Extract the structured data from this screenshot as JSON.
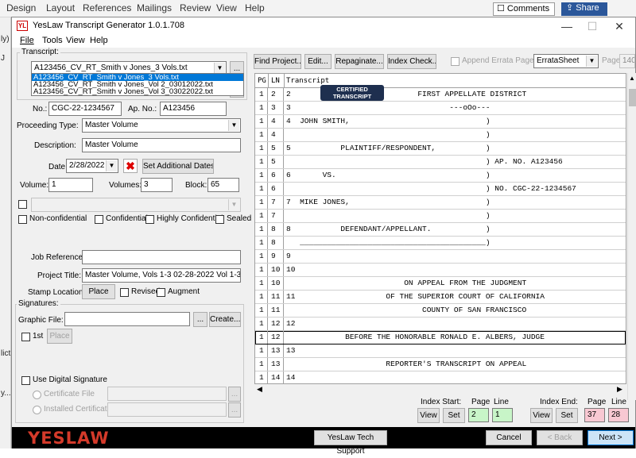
{
  "word": {
    "menu": [
      "Design",
      "Layout",
      "References",
      "Mailings",
      "Review",
      "View",
      "Help"
    ],
    "comments": "Comments",
    "share": "Share",
    "left_fragments": [
      "ly)",
      "J",
      "lict",
      "y..."
    ]
  },
  "window": {
    "title": "YesLaw Transcript Generator 1.0.1.708",
    "icon_text": "YL",
    "minimize": "—",
    "maximize": "☐",
    "close": "✕"
  },
  "menu": {
    "file": "File",
    "tools": "Tools",
    "view": "View",
    "help": "Help"
  },
  "transcript": {
    "legend": "Transcript:",
    "selected": "A123456_CV_RT_Smith v Jones_3 Vols.txt",
    "browse": "...",
    "options": [
      "A123456_CV_RT_Smith v Jones_3 Vols.txt",
      "A123456_CV_RT_Smith v Jones_Vol 2_03012022.txt",
      "A123456_CV_RT_Smith v Jones_Vol 3_03022022.txt"
    ],
    "close_icon": "✖"
  },
  "case": {
    "no_label": "No.:",
    "no_value": "CGC-22-1234567",
    "ap_label": "Ap. No.:",
    "ap_value": "A123456"
  },
  "proceeding": {
    "label": "Proceeding Type:",
    "value": "Master Volume"
  },
  "description": {
    "label": "Description:",
    "value": "Master Volume"
  },
  "date": {
    "label": "Date:",
    "value": "2/28/2022",
    "set_additional": "Set Additional Dates..."
  },
  "volume": {
    "label": "Volume:",
    "value": "1",
    "volumes_label": "Volumes:",
    "volumes_value": "3",
    "block_label": "Block:",
    "block_value": "65"
  },
  "confidentiality": [
    "Non-confidential",
    "Confidential",
    "Highly Confidential",
    "Sealed"
  ],
  "job_reference": {
    "label": "Job Reference:",
    "value": ""
  },
  "project_title": {
    "label": "Project Title:",
    "value": "Master Volume, Vols 1-3 02-28-2022 Vol 1-3"
  },
  "stamp": {
    "label": "Stamp Location:",
    "place": "Place",
    "revised": "Revised",
    "augment": "Augment"
  },
  "signatures": {
    "legend": "Signatures:",
    "graphic_label": "Graphic File:",
    "graphic_value": "",
    "browse": "...",
    "create": "Create...",
    "first": "1st",
    "place": "Place",
    "digital": "Use Digital Signature",
    "cert_file": "Certificate File",
    "installed_cert": "Installed Certificate"
  },
  "toolbar": {
    "find_project": "Find Project...",
    "edit": "Edit...",
    "repaginate": "Repaginate...",
    "index_check": "Index Check...",
    "append_errata": "Append Errata Page",
    "errata_value": "ErrataSheet",
    "page_label": "Page",
    "page_value": "140"
  },
  "table": {
    "headers": {
      "pg": "PG",
      "ln": "LN",
      "transcript": "Transcript"
    },
    "rows": [
      {
        "pg": "1",
        "ln": "2",
        "text": "2                            FIRST APPELLATE DISTRICT"
      },
      {
        "pg": "1",
        "ln": "3",
        "text": "3                                   ---oOo---"
      },
      {
        "pg": "1",
        "ln": "4",
        "text": "4  JOHN SMITH,                              )"
      },
      {
        "pg": "1",
        "ln": "4",
        "text": "                                            )"
      },
      {
        "pg": "1",
        "ln": "5",
        "text": "5           PLAINTIFF/RESPONDENT,           )"
      },
      {
        "pg": "1",
        "ln": "5",
        "text": "                                            ) AP. NO. A123456"
      },
      {
        "pg": "1",
        "ln": "6",
        "text": "6       VS.                                 )"
      },
      {
        "pg": "1",
        "ln": "6",
        "text": "                                            ) NO. CGC-22-1234567"
      },
      {
        "pg": "1",
        "ln": "7",
        "text": "7  MIKE JONES,                              )"
      },
      {
        "pg": "1",
        "ln": "7",
        "text": "                                            )"
      },
      {
        "pg": "1",
        "ln": "8",
        "text": "8           DEFENDANT/APPELLANT.            )"
      },
      {
        "pg": "1",
        "ln": "8",
        "text": "   _________________________________________)"
      },
      {
        "pg": "1",
        "ln": "9",
        "text": "9"
      },
      {
        "pg": "1",
        "ln": "10",
        "text": "10"
      },
      {
        "pg": "1",
        "ln": "10",
        "text": "                          ON APPEAL FROM THE JUDGMENT"
      },
      {
        "pg": "1",
        "ln": "11",
        "text": "11                    OF THE SUPERIOR COURT OF CALIFORNIA"
      },
      {
        "pg": "1",
        "ln": "11",
        "text": "                              COUNTY OF SAN FRANCISCO"
      },
      {
        "pg": "1",
        "ln": "12",
        "text": "12"
      },
      {
        "pg": "1",
        "ln": "12",
        "text": "             BEFORE THE HONORABLE RONALD E. ALBERS, JUDGE"
      },
      {
        "pg": "1",
        "ln": "13",
        "text": "13"
      },
      {
        "pg": "1",
        "ln": "13",
        "text": "                      REPORTER'S TRANSCRIPT ON APPEAL"
      },
      {
        "pg": "1",
        "ln": "14",
        "text": "14"
      }
    ]
  },
  "stamp_badge": {
    "line1": "CERTIFIED",
    "line2": "TRANSCRIPT"
  },
  "index": {
    "start_label": "Index Start:",
    "end_label": "Index End:",
    "page_label": "Page",
    "line_label": "Line",
    "start_page": "2",
    "start_line": "1",
    "end_page": "37",
    "end_line": "28",
    "view": "View",
    "set": "Set"
  },
  "footer": {
    "logo": "YESLAW",
    "support": "YesLaw Tech Support",
    "cancel": "Cancel",
    "back": "< Back",
    "next": "Next >"
  },
  "colors": {
    "accent": "#0078d7",
    "logo": "#d43a2a",
    "green_field": "#c8f5c8",
    "pink_field": "#f8c8d2",
    "badge": "#1e2f4f"
  }
}
